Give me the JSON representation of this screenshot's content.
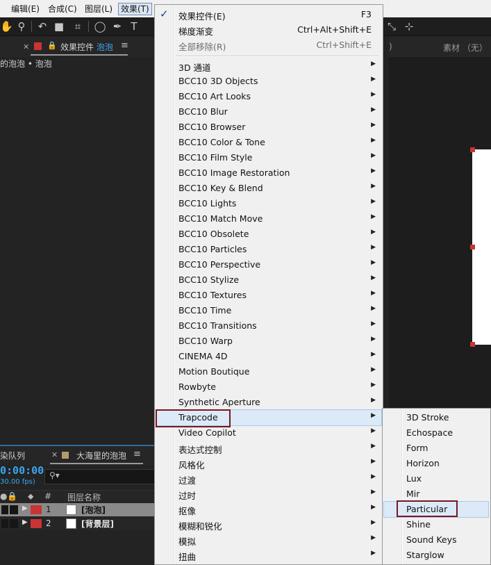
{
  "menubar": {
    "items": [
      {
        "label": "编辑(E)"
      },
      {
        "label": "合成(C)"
      },
      {
        "label": "图层(L)"
      },
      {
        "label": "效果(T)"
      }
    ]
  },
  "effect_controls_panel": {
    "title_prefix": "效果控件",
    "title_layer": "泡泡",
    "breadcrumb": "的泡泡 • 泡泡"
  },
  "composition_panel": {
    "partial_label": ")",
    "footage_label": "素材 （无）"
  },
  "timeline": {
    "render_queue_tab": "染队列",
    "comp_tab": "大海里的泡泡",
    "timecode": "0:00:00",
    "fps": "30.00 fps)",
    "columns": {
      "hash": "#",
      "layer_name": "图层名称"
    },
    "layers": [
      {
        "number": "1",
        "name": "[泡泡]"
      },
      {
        "number": "2",
        "name": "[背景层]"
      }
    ]
  },
  "effect_menu": {
    "top_items": [
      {
        "label": "效果控件(E)",
        "shortcut": "F3",
        "checked": true
      },
      {
        "label": "梯度渐变",
        "shortcut": "Ctrl+Alt+Shift+E"
      },
      {
        "label": "全部移除(R)",
        "shortcut": "Ctrl+Shift+E",
        "disabled": true
      }
    ],
    "items": [
      {
        "label": "3D 通道"
      },
      {
        "label": "BCC10 3D Objects"
      },
      {
        "label": "BCC10 Art Looks"
      },
      {
        "label": "BCC10 Blur"
      },
      {
        "label": "BCC10 Browser"
      },
      {
        "label": "BCC10 Color & Tone"
      },
      {
        "label": "BCC10 Film Style"
      },
      {
        "label": "BCC10 Image Restoration"
      },
      {
        "label": "BCC10 Key & Blend"
      },
      {
        "label": "BCC10 Lights"
      },
      {
        "label": "BCC10 Match Move"
      },
      {
        "label": "BCC10 Obsolete"
      },
      {
        "label": "BCC10 Particles"
      },
      {
        "label": "BCC10 Perspective"
      },
      {
        "label": "BCC10 Stylize"
      },
      {
        "label": "BCC10 Textures"
      },
      {
        "label": "BCC10 Time"
      },
      {
        "label": "BCC10 Transitions"
      },
      {
        "label": "BCC10 Warp"
      },
      {
        "label": "CINEMA 4D"
      },
      {
        "label": "Motion Boutique"
      },
      {
        "label": "Rowbyte"
      },
      {
        "label": "Synthetic Aperture"
      },
      {
        "label": "Trapcode",
        "selected": true
      },
      {
        "label": "Video Copilot"
      },
      {
        "label": "表达式控制"
      },
      {
        "label": "风格化"
      },
      {
        "label": "过渡"
      },
      {
        "label": "过时"
      },
      {
        "label": "抠像"
      },
      {
        "label": "模糊和锐化"
      },
      {
        "label": "模拟"
      },
      {
        "label": "扭曲"
      }
    ]
  },
  "trapcode_submenu": {
    "items": [
      {
        "label": "3D Stroke"
      },
      {
        "label": "Echospace"
      },
      {
        "label": "Form"
      },
      {
        "label": "Horizon"
      },
      {
        "label": "Lux"
      },
      {
        "label": "Mir"
      },
      {
        "label": "Particular",
        "selected": true
      },
      {
        "label": "Shine"
      },
      {
        "label": "Sound Keys"
      },
      {
        "label": "Starglow"
      }
    ]
  },
  "icons": {
    "checkmark": "check-icon",
    "submenu_arrow": "triangle-right-icon",
    "highlight_color": "#7a1620",
    "accent_color": "#3aa7f0",
    "label_color": "#c93434"
  }
}
